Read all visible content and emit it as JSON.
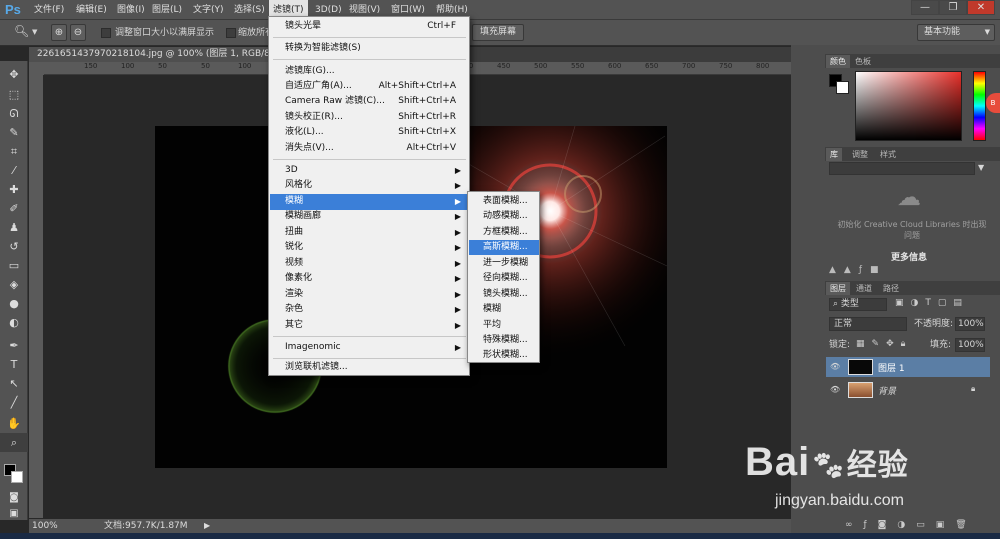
{
  "app": {
    "logo": "Ps"
  },
  "menubar": {
    "items": [
      "文件(F)",
      "编辑(E)",
      "图像(I)",
      "图层(L)",
      "文字(Y)",
      "选择(S)",
      "滤镜(T)",
      "3D(D)",
      "视图(V)",
      "窗口(W)",
      "帮助(H)"
    ],
    "active": "滤镜(T)"
  },
  "window_controls": {
    "minimize": "—",
    "restore": "❐",
    "close": "✕"
  },
  "options_bar": {
    "resize_windows": "调整窗口大小以满屏显示",
    "zoom_all": "缩放所有",
    "fill_screen": "填充屏幕",
    "workspace": "基本功能"
  },
  "document": {
    "tab_title": "2261651437970218104.jpg @ 100% (图层 1, RGB/8#) *",
    "tab_close": "×",
    "ruler_ticks": [
      "150",
      "100",
      "50",
      "0",
      "50",
      "100",
      "150",
      "200",
      "250",
      "300",
      "350",
      "400",
      "450",
      "500",
      "550",
      "600",
      "650",
      "700",
      "750",
      "800"
    ]
  },
  "status_bar": {
    "zoom": "100%",
    "doc_info": "文档:957.7K/1.87M"
  },
  "filter_menu": {
    "items": [
      {
        "label": "镜头光晕",
        "shortcut": "Ctrl+F"
      },
      {
        "label": "转换为智能滤镜(S)",
        "shortcut": ""
      },
      {
        "label": "滤镜库(G)...",
        "shortcut": ""
      },
      {
        "label": "自适应广角(A)...",
        "shortcut": "Alt+Shift+Ctrl+A"
      },
      {
        "label": "Camera Raw 滤镜(C)...",
        "shortcut": "Shift+Ctrl+A"
      },
      {
        "label": "镜头校正(R)...",
        "shortcut": "Shift+Ctrl+R"
      },
      {
        "label": "液化(L)...",
        "shortcut": "Shift+Ctrl+X"
      },
      {
        "label": "消失点(V)...",
        "shortcut": "Alt+Ctrl+V"
      },
      {
        "label": "3D",
        "submenu": true
      },
      {
        "label": "风格化",
        "submenu": true
      },
      {
        "label": "模糊",
        "submenu": true,
        "highlighted": true
      },
      {
        "label": "模糊画廊",
        "submenu": true
      },
      {
        "label": "扭曲",
        "submenu": true
      },
      {
        "label": "锐化",
        "submenu": true
      },
      {
        "label": "视频",
        "submenu": true
      },
      {
        "label": "像素化",
        "submenu": true
      },
      {
        "label": "渲染",
        "submenu": true
      },
      {
        "label": "杂色",
        "submenu": true
      },
      {
        "label": "其它",
        "submenu": true
      },
      {
        "label": "Imagenomic",
        "submenu": true
      },
      {
        "label": "浏览联机滤镜...",
        "shortcut": ""
      }
    ],
    "submenu_arrow": "▶"
  },
  "blur_submenu": {
    "items": [
      "表面模糊...",
      "动感模糊...",
      "方框模糊...",
      "高斯模糊...",
      "进一步模糊",
      "径向模糊...",
      "镜头模糊...",
      "模糊",
      "平均",
      "特殊模糊...",
      "形状模糊..."
    ],
    "highlighted": "高斯模糊..."
  },
  "right_panel": {
    "color_tabs": [
      "颜色",
      "色板"
    ],
    "library_tabs": [
      "库",
      "调整",
      "样式"
    ],
    "cc_message": "初始化 Creative Cloud Libraries 时出现问题",
    "more_info": "更多信息",
    "layers_tabs": [
      "图层",
      "通道",
      "路径"
    ],
    "filter_kind": "类型",
    "blend_mode": "正常",
    "opacity_label": "不透明度:",
    "opacity_value": "100%",
    "lock_label": "锁定:",
    "fill_label": "填充:",
    "fill_value": "100%",
    "layers": [
      {
        "name": "图层 1",
        "selected": true
      },
      {
        "name": "背景",
        "selected": false,
        "locked": true
      }
    ],
    "colors": {
      "foreground": "#000000",
      "background": "#ffffff",
      "hue_marker": "#e8302a"
    }
  },
  "watermark": {
    "brand": "Bai",
    "brand2": "经验",
    "url": "jingyan.baidu.com"
  },
  "accent": "#3b7fd8"
}
